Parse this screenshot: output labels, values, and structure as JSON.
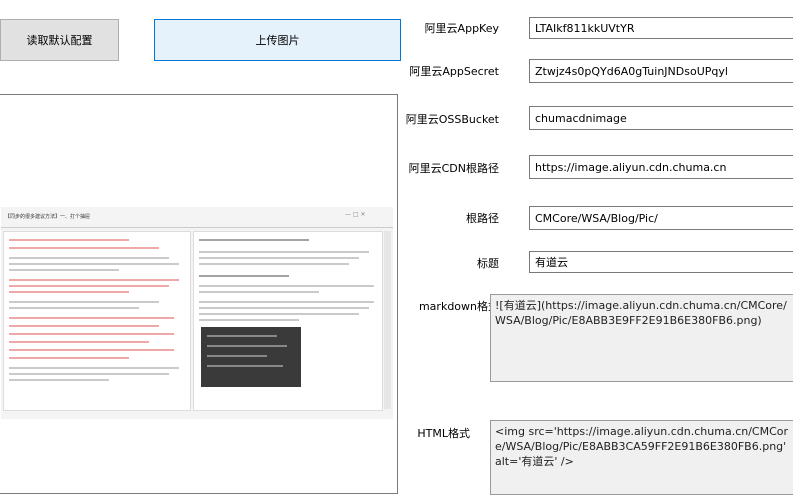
{
  "buttons": {
    "load_default": "读取默认配置",
    "upload_image": "上传图片"
  },
  "form": {
    "appkey_label": "阿里云AppKey",
    "appkey_value": "LTAIkf811kkUVtYR",
    "appsecret_label": "阿里云AppSecret",
    "appsecret_value": "Ztwjz4s0pQYd6A0gTuinJNDsoUPqyl",
    "bucket_label": "阿里云OSSBucket",
    "bucket_value": "chumacdnimage",
    "cdn_label": "阿里云CDN根路径",
    "cdn_value": "https://image.aliyun.cdn.chuma.cn",
    "rootpath_label": "根路径",
    "rootpath_value": "CMCore/WSA/Blog/Pic/",
    "title_label": "标题",
    "title_value": "有道云",
    "markdown_label": "markdown格式",
    "markdown_value": "![有道云](https://image.aliyun.cdn.chuma.cn/CMCore/WSA/Blog/Pic/E8ABB3E9FF2E91B6E380FB6.png)",
    "html_label": "HTML格式",
    "html_value": "<img src='https://image.aliyun.cdn.chuma.cn/CMCore/WSA/Blog/Pic/E8ABB3CA59FF2E91B6E380FB6.png' alt='有道云' />"
  },
  "preview": {
    "doc_title": "【同步的很多建议方法】一、打个抽屉"
  }
}
